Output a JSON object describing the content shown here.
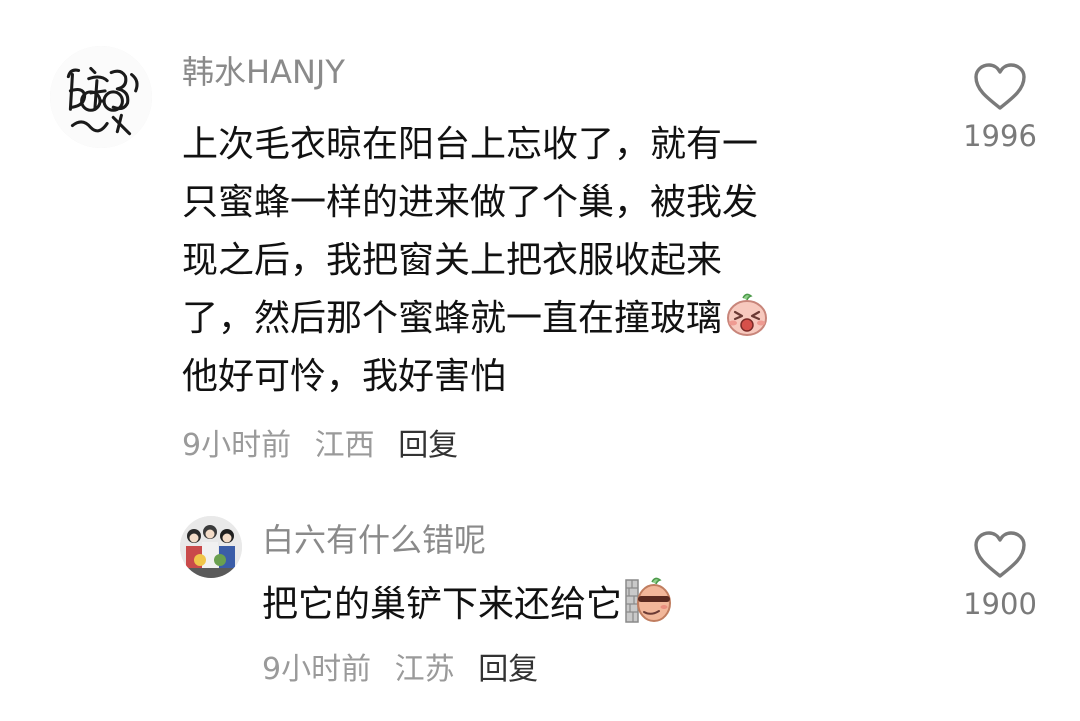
{
  "comment": {
    "username": "韩水HANJY",
    "lines": [
      "上次毛衣晾在阳台上忘收了，就有一",
      "只蜜蜂一样的进来做了个巢，被我发",
      "现之后，我把窗关上把衣服收起来",
      "了，然后那个蜜蜂就一直在撞玻璃",
      "他好可怜，我好害怕"
    ],
    "emoji_icon": "crying-face-emoji",
    "time": "9小时前",
    "location": "江西",
    "reply_label": "回复",
    "like_icon": "heart-outline-icon",
    "like_count": "1996"
  },
  "reply": {
    "username": "白六有什么错呢",
    "text": "把它的巢铲下来还给它",
    "emoji_icon": "peeking-smirk-emoji",
    "time": "9小时前",
    "location": "江苏",
    "reply_label": "回复",
    "like_icon": "heart-outline-icon",
    "like_count": "1900"
  },
  "colors": {
    "username": "#8a8a8a",
    "text": "#111111",
    "meta": "#9a9a9a",
    "reply_action": "#333333",
    "like_icon": "#7a7a7a"
  }
}
